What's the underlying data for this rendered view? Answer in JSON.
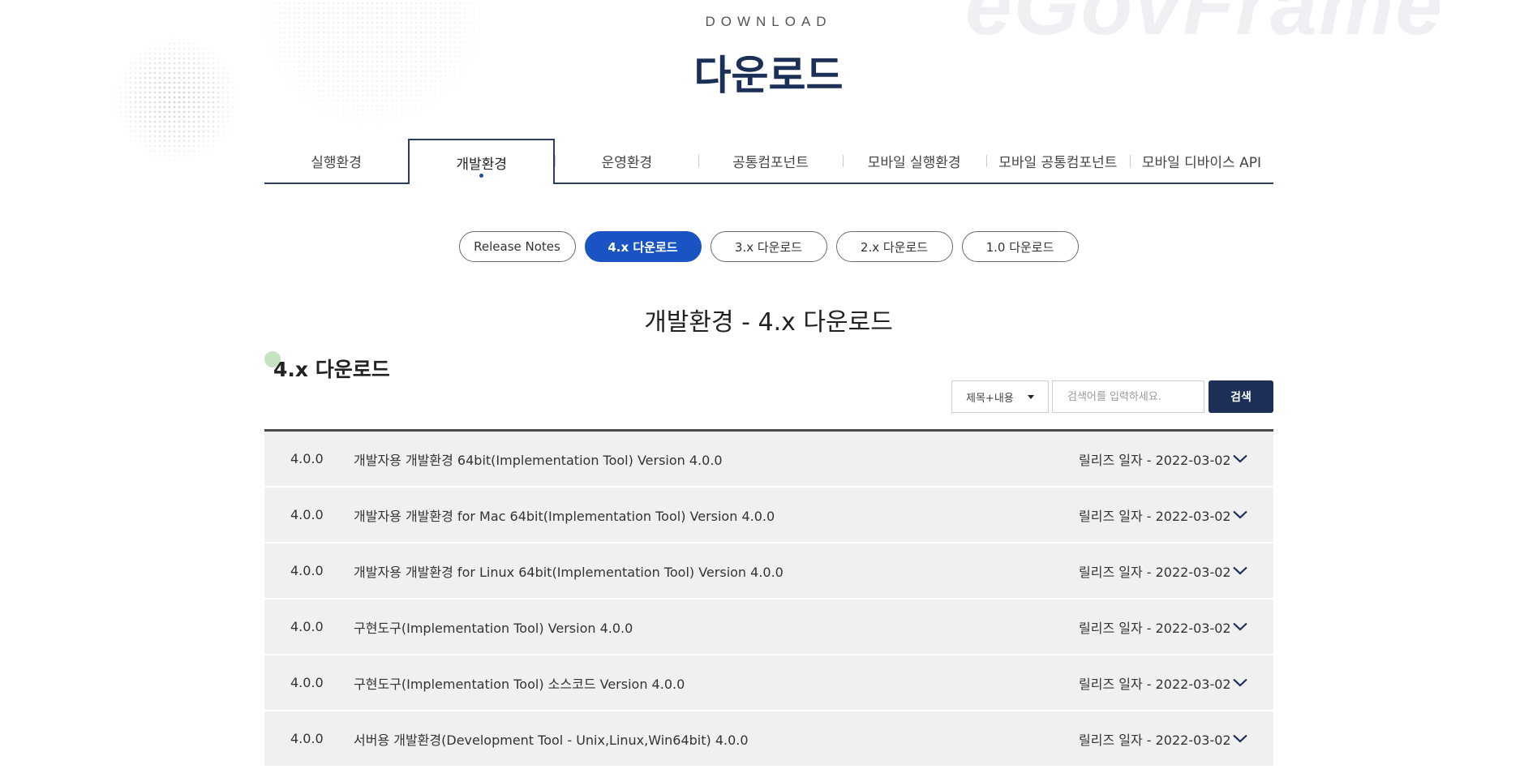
{
  "watermark": "eGovFrame",
  "header": {
    "eyebrow": "DOWNLOAD",
    "title": "다운로드"
  },
  "tabs": [
    {
      "label": "실행환경",
      "active": false
    },
    {
      "label": "개발환경",
      "active": true
    },
    {
      "label": "운영환경",
      "active": false
    },
    {
      "label": "공통컴포넌트",
      "active": false
    },
    {
      "label": "모바일 실행환경",
      "active": false
    },
    {
      "label": "모바일 공통컴포넌트",
      "active": false
    },
    {
      "label": "모바일 디바이스 API",
      "active": false
    }
  ],
  "subtabs": [
    {
      "label": "Release Notes",
      "active": false
    },
    {
      "label": "4.x 다운로드",
      "active": true
    },
    {
      "label": "3.x 다운로드",
      "active": false
    },
    {
      "label": "2.x 다운로드",
      "active": false
    },
    {
      "label": "1.0 다운로드",
      "active": false
    }
  ],
  "section_title": "개발환경 - 4.x 다운로드",
  "sub_title": "4.x 다운로드",
  "search": {
    "scope_selected": "제목+내용",
    "placeholder": "검색어를 입력하세요.",
    "button_label": "검색"
  },
  "downloads": [
    {
      "version": "4.0.0",
      "name": "개발자용 개발환경 64bit(Implementation Tool) Version 4.0.0",
      "release": "릴리즈 일자 - 2022-03-02"
    },
    {
      "version": "4.0.0",
      "name": "개발자용 개발환경 for Mac 64bit(Implementation Tool) Version 4.0.0",
      "release": "릴리즈 일자 - 2022-03-02"
    },
    {
      "version": "4.0.0",
      "name": "개발자용 개발환경 for Linux 64bit(Implementation Tool) Version 4.0.0",
      "release": "릴리즈 일자 - 2022-03-02"
    },
    {
      "version": "4.0.0",
      "name": "구현도구(Implementation Tool) Version 4.0.0",
      "release": "릴리즈 일자 - 2022-03-02"
    },
    {
      "version": "4.0.0",
      "name": "구현도구(Implementation Tool) 소스코드 Version 4.0.0",
      "release": "릴리즈 일자 - 2022-03-02"
    },
    {
      "version": "4.0.0",
      "name": "서버용 개발환경(Development Tool - Unix,Linux,Win64bit) 4.0.0",
      "release": "릴리즈 일자 - 2022-03-02"
    }
  ],
  "colors": {
    "navy": "#1b2f57",
    "accent_blue": "#1a54c4",
    "row_bg": "#f0f0f0"
  }
}
